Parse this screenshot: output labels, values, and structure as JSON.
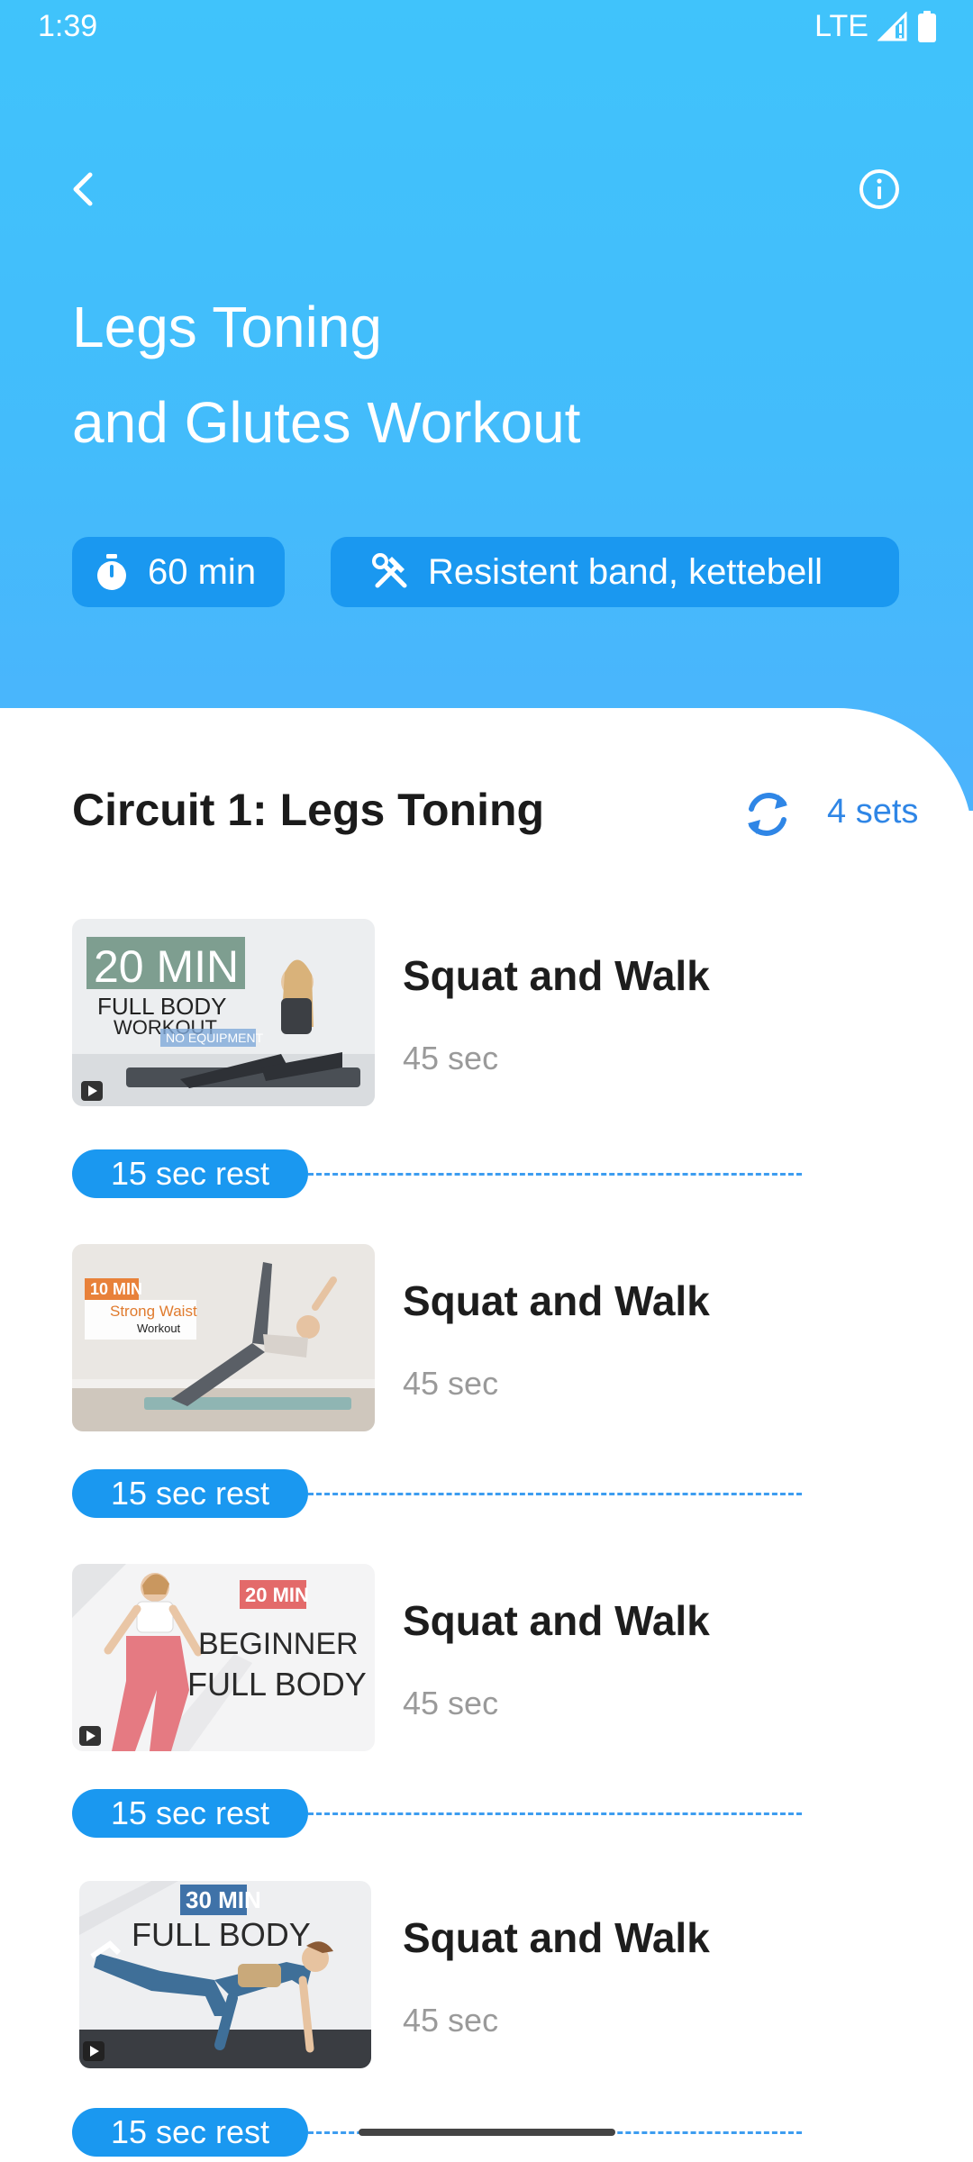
{
  "status_bar": {
    "time": "1:39",
    "network": "LTE"
  },
  "header": {
    "title_line1": "Legs Toning",
    "title_line2": "and Glutes Workout",
    "duration": "60 min",
    "equipment": "Resistent band, kettebell",
    "bg_color": "#42bffb",
    "chip_color": "#1a98f0"
  },
  "circuit": {
    "title": "Circuit 1: Legs Toning",
    "sets": "4 sets",
    "accent_color": "#2f86e6"
  },
  "exercises": [
    {
      "name": "Squat and Walk",
      "duration": "45 sec",
      "rest": "15 sec rest",
      "thumb": {
        "line1": "20 MIN",
        "line2": "FULL BODY",
        "line3": "WORKOUT",
        "line4": "NO EQUIPMENT"
      }
    },
    {
      "name": "Squat and Walk",
      "duration": "45 sec",
      "rest": "15 sec rest",
      "thumb": {
        "line1": "10 MIN",
        "line2": "Strong Waist",
        "line3": "Workout"
      }
    },
    {
      "name": "Squat and Walk",
      "duration": "45 sec",
      "rest": "15 sec rest",
      "thumb": {
        "line1": "20 MIN",
        "line2": "BEGINNER",
        "line3": "FULL BODY"
      }
    },
    {
      "name": "Squat and Walk",
      "duration": "45 sec",
      "rest": "15 sec rest",
      "thumb": {
        "line1": "30 MIN",
        "line2": "FULL BODY"
      }
    }
  ],
  "icons": [
    "back-arrow-icon",
    "info-icon",
    "timer-icon",
    "tools-icon",
    "repeat-icon",
    "play-icon",
    "signal-icon",
    "battery-icon"
  ]
}
